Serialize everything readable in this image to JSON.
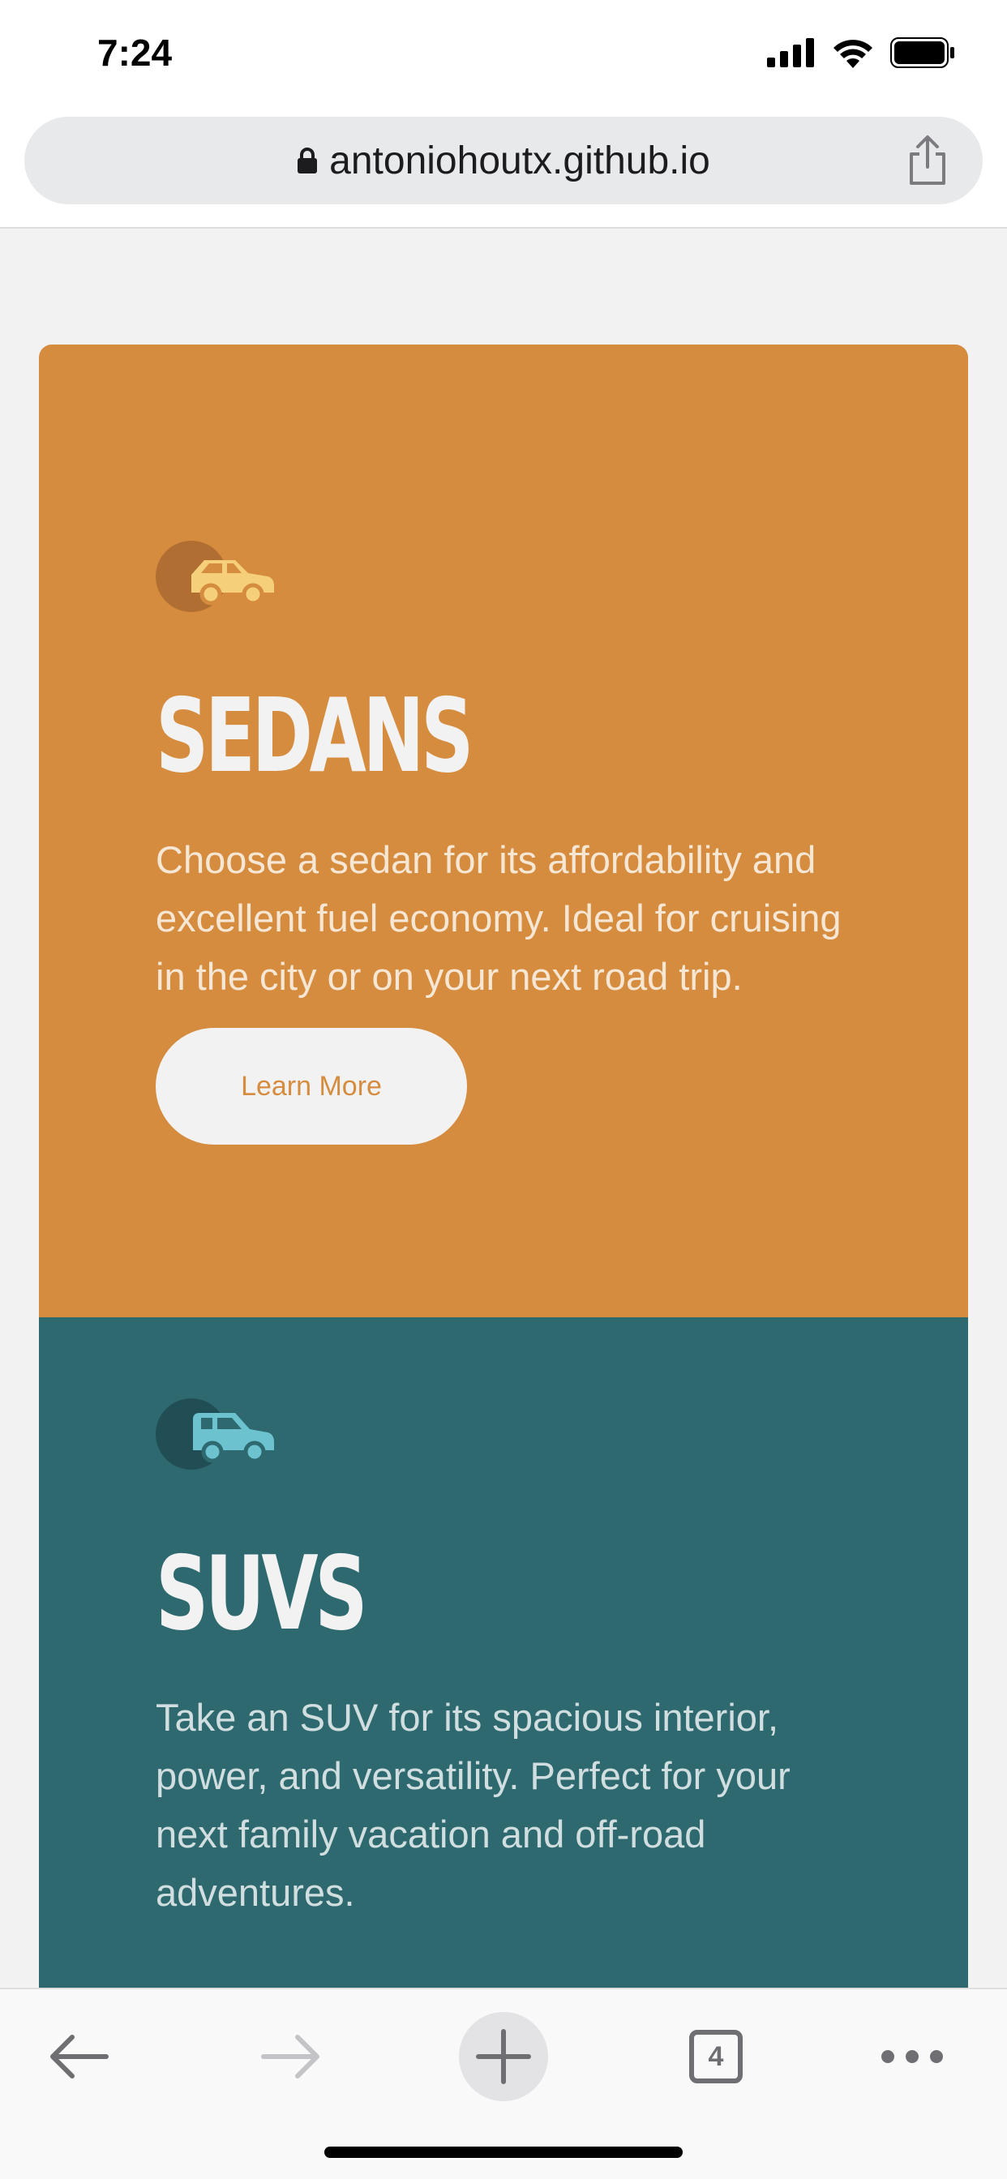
{
  "status_bar": {
    "time": "7:24",
    "icons": [
      "signal-icon",
      "wifi-icon",
      "battery-icon"
    ]
  },
  "browser": {
    "url": "antoniohoutx.github.io",
    "lock_icon": "lock-icon",
    "share_icon": "share-icon"
  },
  "cards": [
    {
      "title": "SEDANS",
      "text": "Choose a sedan for its affordability and excellent fuel economy. Ideal for cruising in the city or on your next road trip.",
      "button_label": "Learn More",
      "icon": "sedan-icon",
      "color": "#d58c3e"
    },
    {
      "title": "SUVS",
      "text": "Take an SUV for its spacious interior, power, and versatility. Perfect for your next family vacation and off-road adventures.",
      "icon": "suv-icon",
      "color": "#2e6970"
    }
  ],
  "toolbar": {
    "tab_count": "4",
    "icons": [
      "back-arrow-icon",
      "forward-arrow-icon",
      "plus-icon",
      "tabs-icon",
      "more-icon"
    ]
  }
}
